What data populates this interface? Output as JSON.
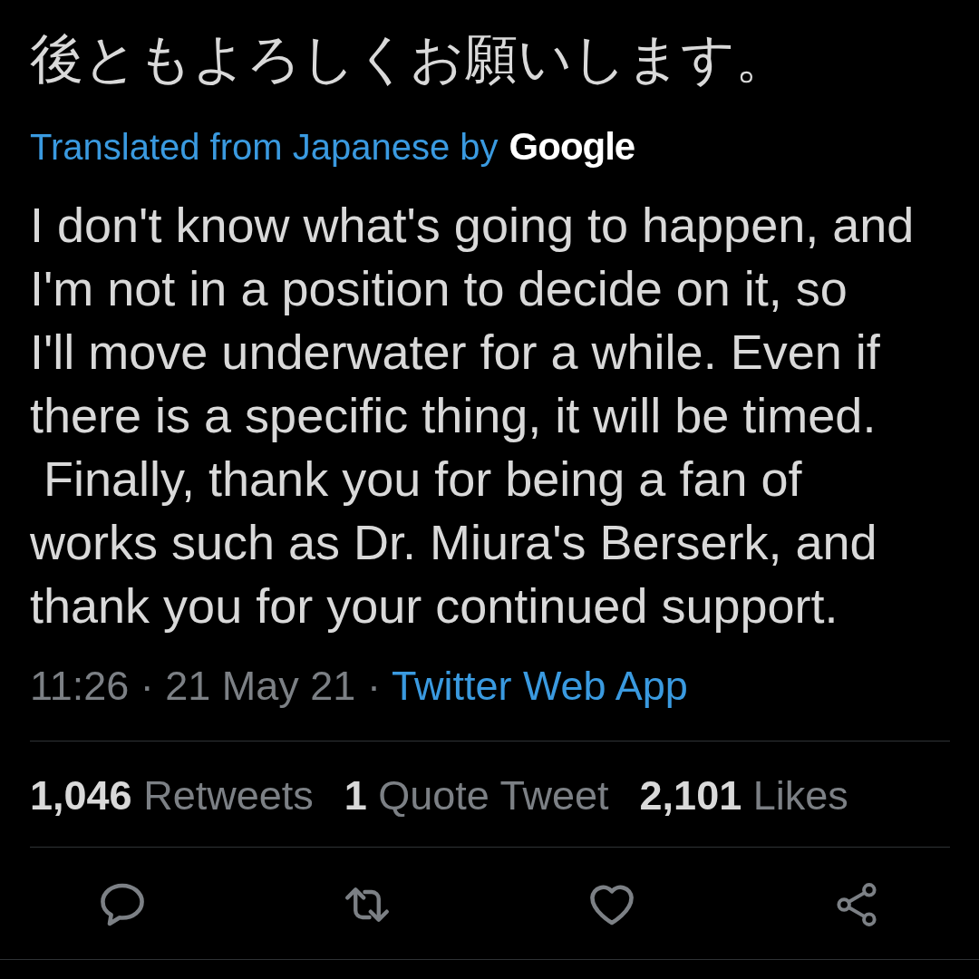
{
  "tweet": {
    "original_text": "後ともよろしくお願いします。",
    "translation": {
      "label": "Translated from Japanese by",
      "provider": "Google"
    },
    "translated_text": "I don't know what's going to happen, and\nI'm not in a position to decide on it, so\nI'll move underwater for a while. Even if\nthere is a specific thing, it will be timed.\n Finally, thank you for being a fan of\nworks such as Dr. Miura's Berserk, and\nthank you for your continued support.",
    "timestamp": "11:26 · 21 May 21 ·",
    "source": "Twitter Web App"
  },
  "stats": [
    {
      "count": "1,046",
      "label": "Retweets"
    },
    {
      "count": "1",
      "label": "Quote Tweet"
    },
    {
      "count": "2,101",
      "label": "Likes"
    }
  ],
  "actions": [
    {
      "kind": "reply"
    },
    {
      "kind": "retweet"
    },
    {
      "kind": "like"
    },
    {
      "kind": "share"
    }
  ]
}
